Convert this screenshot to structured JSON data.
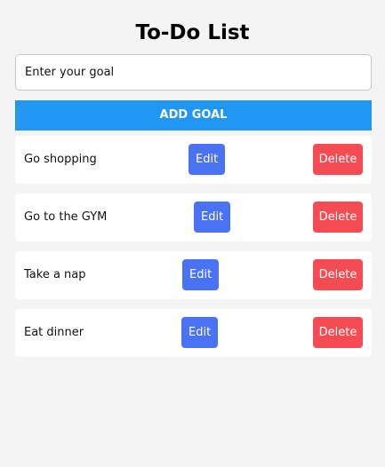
{
  "header": {
    "title": "To-Do List"
  },
  "goal_input": {
    "placeholder": "Enter your goal",
    "value": ""
  },
  "add_button": {
    "label": "ADD GOAL"
  },
  "goals": [
    {
      "text": "Go shopping",
      "edit_label": "Edit",
      "delete_label": "Delete"
    },
    {
      "text": "Go to the GYM",
      "edit_label": "Edit",
      "delete_label": "Delete"
    },
    {
      "text": "Take a nap",
      "edit_label": "Edit",
      "delete_label": "Delete"
    },
    {
      "text": "Eat dinner",
      "edit_label": "Edit",
      "delete_label": "Delete"
    }
  ],
  "colors": {
    "background": "#f4f4f4",
    "add_button": "#2196f3",
    "edit_button": "#4a72f5",
    "delete_button": "#f54b52",
    "row_background": "#ffffff"
  }
}
